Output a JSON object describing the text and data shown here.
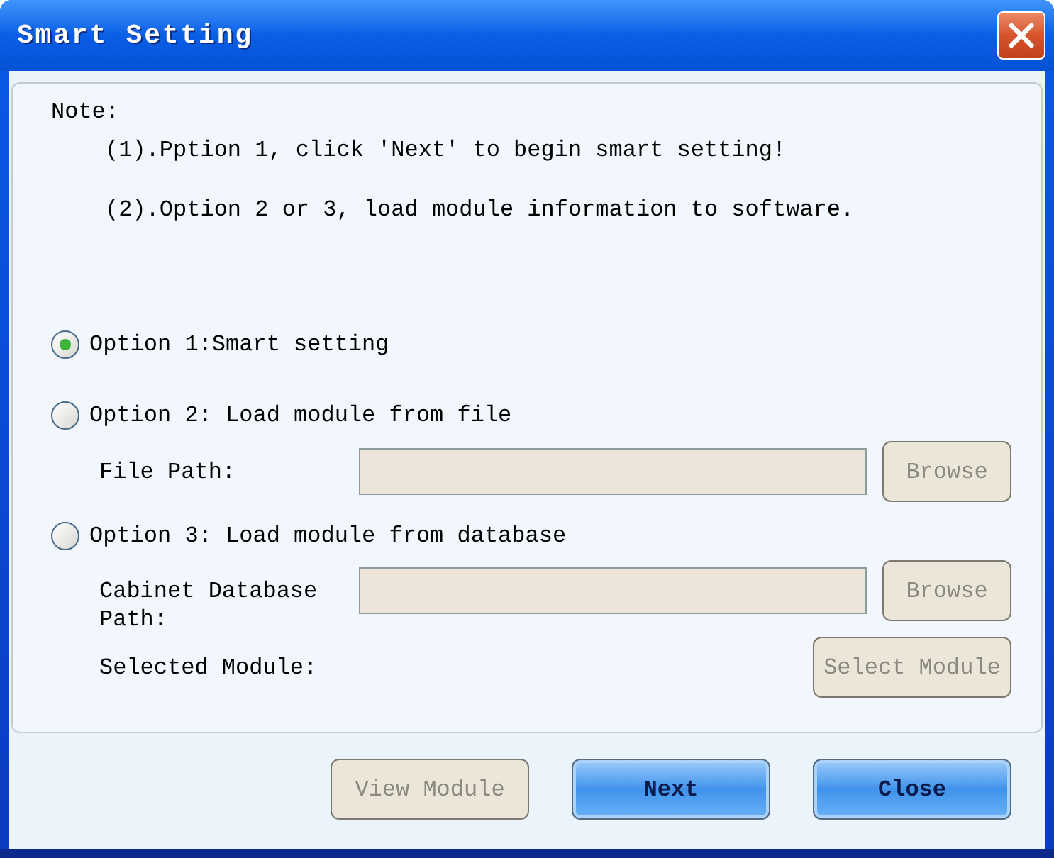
{
  "window": {
    "title": "Smart Setting"
  },
  "note": {
    "heading": "Note:",
    "lines": [
      "(1).Pption 1, click 'Next' to begin smart setting!",
      "(2).Option 2 or 3, load module information to software."
    ]
  },
  "options": [
    {
      "label": "Option 1:Smart setting",
      "selected": true
    },
    {
      "label": "Option 2: Load module from file",
      "selected": false,
      "rows": [
        {
          "kind": "path",
          "label": "File Path:",
          "field": {
            "disabled": true
          },
          "button": {
            "label": "Browse",
            "disabled": true
          }
        }
      ]
    },
    {
      "label": "Option 3: Load module from database",
      "selected": false,
      "rows": [
        {
          "kind": "path",
          "label": "Cabinet Database Path:",
          "field": {
            "disabled": true
          },
          "button": {
            "label": "Browse",
            "disabled": true
          }
        },
        {
          "kind": "action",
          "label": "Selected Module:",
          "button": {
            "label": "Select Module",
            "disabled": true
          }
        }
      ]
    }
  ],
  "buttons": [
    {
      "label": "View Module",
      "kind": "plain",
      "disabled": true
    },
    {
      "label": "Next",
      "kind": "primary",
      "disabled": false
    },
    {
      "label": "Close",
      "kind": "primary",
      "disabled": false
    }
  ]
}
